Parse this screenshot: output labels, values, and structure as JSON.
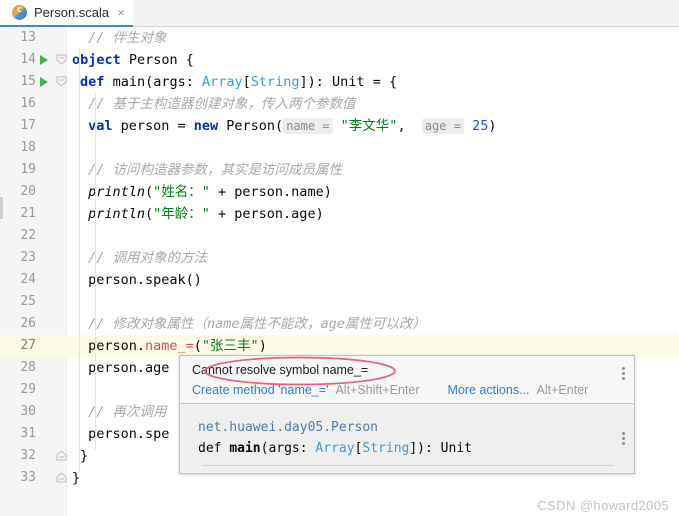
{
  "tab": {
    "label": "Person.scala",
    "icon": "scala-class-icon",
    "close": "×"
  },
  "editor": {
    "current_line": 27,
    "lines": [
      {
        "num": "13",
        "indent": 2,
        "run": false,
        "fold": null,
        "tokens": [
          {
            "t": "cmt",
            "v": "// 伴生对象"
          }
        ]
      },
      {
        "num": "14",
        "indent": 0,
        "run": true,
        "fold": "collapse",
        "tokens": [
          {
            "t": "kw",
            "v": "object"
          },
          {
            "t": "ident",
            "v": " Person {"
          }
        ]
      },
      {
        "num": "15",
        "indent": 1,
        "run": true,
        "fold": "collapse",
        "tokens": [
          {
            "t": "kw",
            "v": "def"
          },
          {
            "t": "ident",
            "v": " main(args: "
          },
          {
            "t": "typ",
            "v": "Array"
          },
          {
            "t": "ident",
            "v": "["
          },
          {
            "t": "typ",
            "v": "String"
          },
          {
            "t": "ident",
            "v": "]): Unit = {"
          }
        ]
      },
      {
        "num": "16",
        "indent": 2,
        "run": false,
        "fold": null,
        "tokens": [
          {
            "t": "cmt",
            "v": "// 基于主构造器创建对象，传入两个参数值"
          }
        ]
      },
      {
        "num": "17",
        "indent": 2,
        "run": false,
        "fold": null,
        "tokens": [
          {
            "t": "kw",
            "v": "val"
          },
          {
            "t": "ident",
            "v": " person = "
          },
          {
            "t": "kw",
            "v": "new"
          },
          {
            "t": "ident",
            "v": " Person("
          },
          {
            "t": "hint",
            "v": "name ="
          },
          {
            "t": "str",
            "v": " \"李文华\""
          },
          {
            "t": "ident",
            "v": ",  "
          },
          {
            "t": "hint",
            "v": "age ="
          },
          {
            "t": "num",
            "v": " 25"
          },
          {
            "t": "ident",
            "v": ")"
          }
        ]
      },
      {
        "num": "18",
        "indent": 2,
        "run": false,
        "fold": null,
        "tokens": []
      },
      {
        "num": "19",
        "indent": 2,
        "run": false,
        "fold": null,
        "tokens": [
          {
            "t": "cmt",
            "v": "// 访问构造器参数，其实是访问成员属性"
          }
        ]
      },
      {
        "num": "20",
        "indent": 2,
        "run": false,
        "fold": null,
        "tokens": [
          {
            "t": "mth",
            "v": "println"
          },
          {
            "t": "ident",
            "v": "("
          },
          {
            "t": "str",
            "v": "\"姓名：\""
          },
          {
            "t": "ident",
            "v": " + person.name)"
          }
        ]
      },
      {
        "num": "21",
        "indent": 2,
        "run": false,
        "fold": null,
        "tokens": [
          {
            "t": "mth",
            "v": "println"
          },
          {
            "t": "ident",
            "v": "("
          },
          {
            "t": "str",
            "v": "\"年龄：\""
          },
          {
            "t": "ident",
            "v": " + person.age)"
          }
        ]
      },
      {
        "num": "22",
        "indent": 2,
        "run": false,
        "fold": null,
        "tokens": []
      },
      {
        "num": "23",
        "indent": 2,
        "run": false,
        "fold": null,
        "tokens": [
          {
            "t": "cmt",
            "v": "// 调用对象的方法"
          }
        ]
      },
      {
        "num": "24",
        "indent": 2,
        "run": false,
        "fold": null,
        "tokens": [
          {
            "t": "ident",
            "v": "person.speak()"
          }
        ]
      },
      {
        "num": "25",
        "indent": 2,
        "run": false,
        "fold": null,
        "tokens": []
      },
      {
        "num": "26",
        "indent": 2,
        "run": false,
        "fold": null,
        "tokens": [
          {
            "t": "cmt",
            "v": "// 修改对象属性（name属性不能改，age属性可以改）"
          }
        ]
      },
      {
        "num": "27",
        "indent": 2,
        "run": false,
        "fold": null,
        "tokens": [
          {
            "t": "ident",
            "v": "person."
          },
          {
            "t": "err",
            "v": "name_="
          },
          {
            "t": "ident",
            "v": "("
          },
          {
            "t": "str",
            "v": "\"张三丰\""
          },
          {
            "t": "ident",
            "v": ")"
          }
        ]
      },
      {
        "num": "28",
        "indent": 2,
        "run": false,
        "fold": null,
        "tokens": [
          {
            "t": "ident",
            "v": "person.age"
          }
        ]
      },
      {
        "num": "29",
        "indent": 2,
        "run": false,
        "fold": null,
        "tokens": []
      },
      {
        "num": "30",
        "indent": 2,
        "run": false,
        "fold": null,
        "tokens": [
          {
            "t": "cmt",
            "v": "// 再次调用"
          }
        ]
      },
      {
        "num": "31",
        "indent": 2,
        "run": false,
        "fold": null,
        "tokens": [
          {
            "t": "ident",
            "v": "person.spe"
          }
        ]
      },
      {
        "num": "32",
        "indent": 1,
        "run": false,
        "fold": "end",
        "tokens": [
          {
            "t": "ident",
            "v": "}"
          }
        ]
      },
      {
        "num": "33",
        "indent": 0,
        "run": false,
        "fold": "end",
        "tokens": [
          {
            "t": "ident",
            "v": "}"
          }
        ]
      }
    ]
  },
  "popup": {
    "message": "Cannot resolve symbol name_=",
    "create_method_label": "Create method 'name_='",
    "create_method_shortcut": "Alt+Shift+Enter",
    "more_actions_label": "More actions...",
    "more_actions_shortcut": "Alt+Enter",
    "kebab_icon": "more-options-icon",
    "doc_fqn": "net.huawei.day05.Person",
    "doc_signature_parts": [
      {
        "t": "kwd",
        "v": "def "
      },
      {
        "t": "name",
        "v": "main"
      },
      {
        "t": "plain",
        "v": "(args: "
      },
      {
        "t": "type",
        "v": "Array"
      },
      {
        "t": "plain",
        "v": "["
      },
      {
        "t": "type",
        "v": "String"
      },
      {
        "t": "plain",
        "v": "]): Unit"
      }
    ],
    "annotation": "red-ellipse-highlight"
  },
  "watermark": "CSDN @howard2005",
  "colors": {
    "tab_active_underline": "#4787c7",
    "gutter_bg": "#f5f5f5",
    "current_line_bg": "#fdfae6",
    "error_red": "#d94f4f",
    "annotation_red": "#e8607a",
    "keyword_blue": "#0033b3",
    "string_green": "#067d17",
    "type_blue": "#3c9dd0",
    "comment_gray": "#a8a8a8",
    "link_blue": "#2f7bd4"
  }
}
